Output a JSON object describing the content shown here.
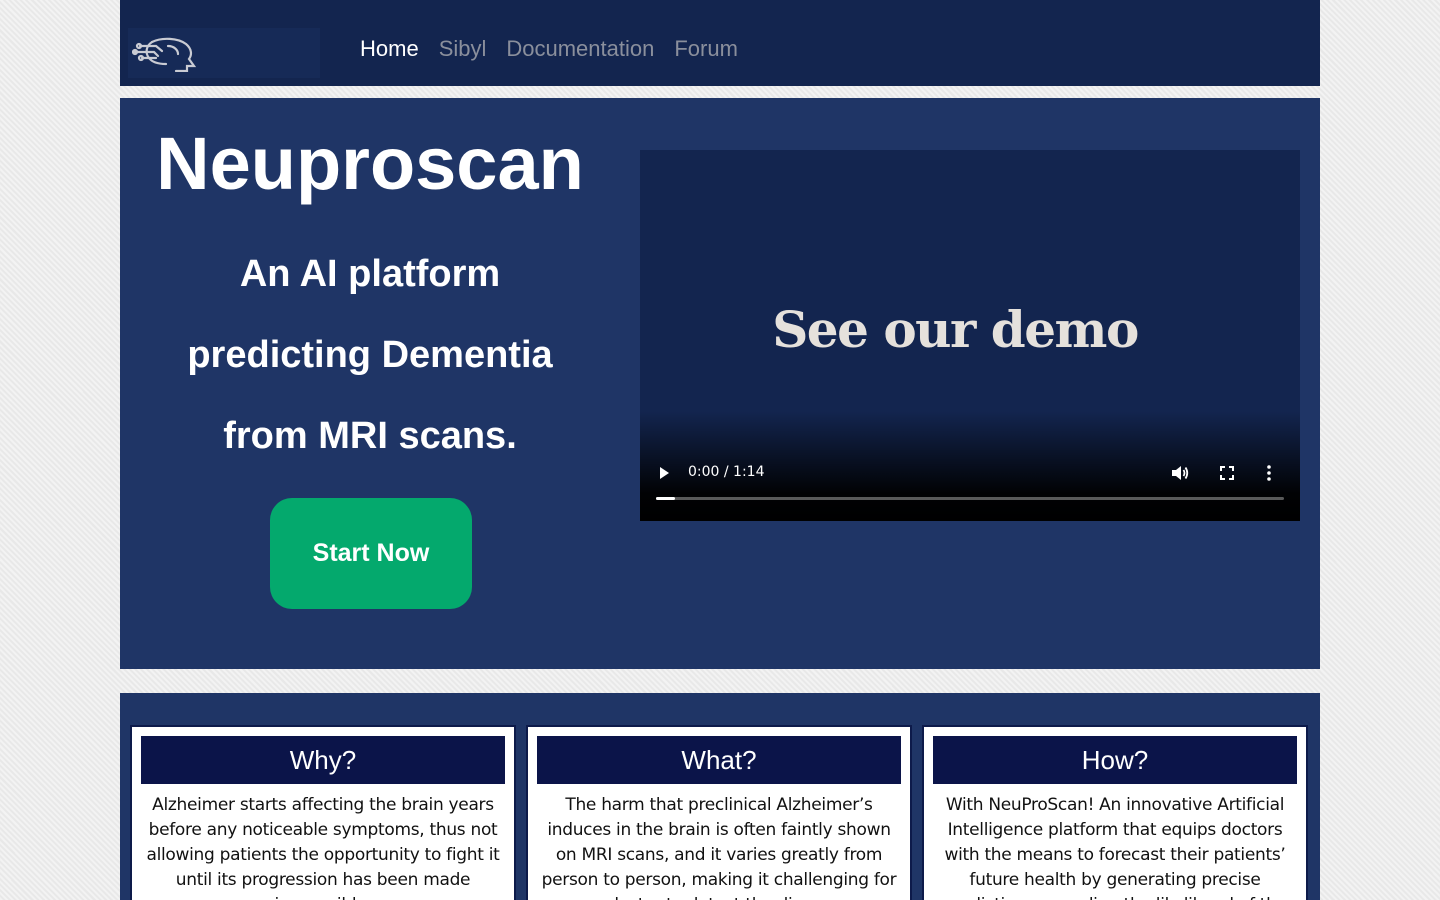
{
  "nav": {
    "logo": "neuroscan-head-logo",
    "links": [
      {
        "label": "Home",
        "active": true
      },
      {
        "label": "Sibyl",
        "active": false
      },
      {
        "label": "Documentation",
        "active": false
      },
      {
        "label": "Forum",
        "active": false
      }
    ]
  },
  "hero": {
    "title": "Neuproscan",
    "subtitle_lines": [
      "An AI platform",
      "predicting Dementia",
      "from MRI scans."
    ],
    "cta_label": "Start Now",
    "accent_color": "#04a96d"
  },
  "video": {
    "overlay_title": "See our demo",
    "time_display": "0:00 / 1:14",
    "progress": 0.03,
    "controls": [
      "play-icon",
      "volume-icon",
      "fullscreen-icon",
      "more-options-icon"
    ]
  },
  "cards": [
    {
      "heading": "Why?",
      "text": "Alzheimer starts affecting the brain years before any noticeable symptoms, thus not allowing patients the opportunity to fight it until its progression has been made irreversible."
    },
    {
      "heading": "What?",
      "text": "The harm that preclinical Alzheimer’s induces in the brain is often faintly shown on MRI scans, and it varies greatly from person to person, making it challenging for a doctor to detect the disease."
    },
    {
      "heading": "How?",
      "text": "With NeuProScan! An innovative Artificial Intelligence platform that equips doctors with the means to forecast their patients’ future health by generating precise predictions regarding the likelihood of the disease."
    }
  ]
}
